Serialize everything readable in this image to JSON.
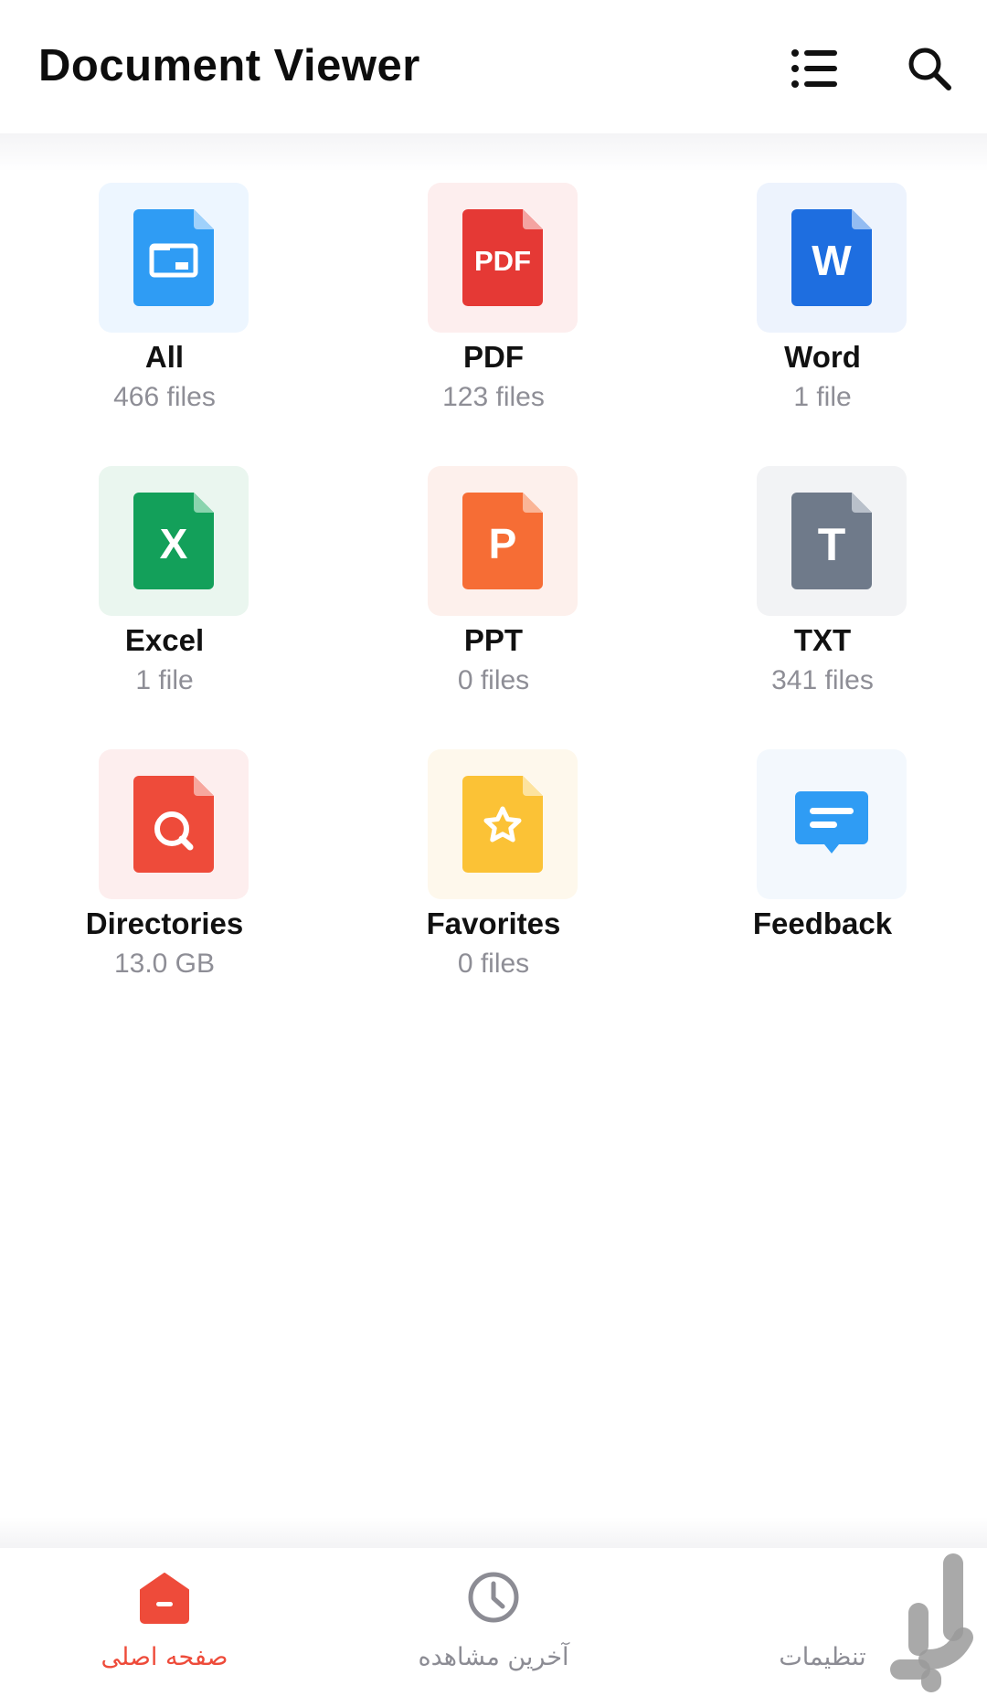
{
  "header": {
    "title": "Document Viewer",
    "list_icon": "list-icon",
    "search_icon": "search-icon"
  },
  "categories": [
    {
      "name": "All",
      "count": "466 files",
      "icon": "folder-file-icon",
      "color": "#2f9cf4",
      "bg": "#edf6ff"
    },
    {
      "name": "PDF",
      "count": "123 files",
      "icon": "pdf-file-icon",
      "color": "#e53935",
      "bg": "#fdeeee",
      "glyph": "PDF"
    },
    {
      "name": "Word",
      "count": "1 file",
      "icon": "word-file-icon",
      "color": "#1e6ee0",
      "bg": "#edf3fd",
      "glyph": "W"
    },
    {
      "name": "Excel",
      "count": "1 file",
      "icon": "excel-file-icon",
      "color": "#13a05a",
      "bg": "#eaf6ef",
      "glyph": "X"
    },
    {
      "name": "PPT",
      "count": "0 files",
      "icon": "ppt-file-icon",
      "color": "#f66d35",
      "bg": "#fdf0ec",
      "glyph": "P"
    },
    {
      "name": "TXT",
      "count": "341 files",
      "icon": "txt-file-icon",
      "color": "#6f7a8a",
      "bg": "#f2f3f5",
      "glyph": "T"
    },
    {
      "name": "Directories",
      "count": "13.0 GB",
      "icon": "directory-search-icon",
      "color": "#ee4b3a",
      "bg": "#fdeeee"
    },
    {
      "name": "Favorites",
      "count": "0 files",
      "icon": "favorites-star-icon",
      "color": "#fbc236",
      "bg": "#fef8ec"
    },
    {
      "name": "Feedback",
      "count": "",
      "icon": "feedback-chat-icon",
      "color": "#2f9cf4",
      "bg": "#f3f8fd"
    }
  ],
  "bottom_nav": [
    {
      "label": "صفحه اصلی",
      "icon": "home-icon",
      "active": true
    },
    {
      "label": "آخرین مشاهده",
      "icon": "clock-icon",
      "active": false
    },
    {
      "label": "تنظیمات",
      "icon": "settings-icon",
      "active": false
    }
  ],
  "colors": {
    "accent": "#ee4b3a",
    "inactive": "#8c8c94",
    "subtitle": "#8e8e96"
  }
}
